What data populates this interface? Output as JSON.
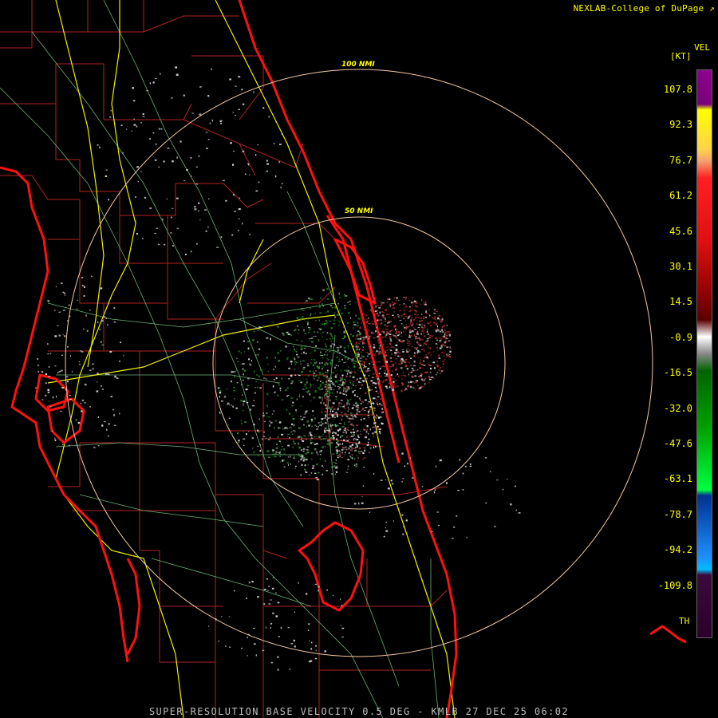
{
  "credit": "NEXLAB-College of DuPage",
  "footer": "SUPER-RESOLUTION BASE VELOCITY 0.5 DEG - KMLB 27 DEC 25 06:02",
  "legend": {
    "title": "VEL",
    "units": "[KT]",
    "ticks": [
      "107.8",
      "92.3",
      "76.7",
      "61.2",
      "45.6",
      "30.1",
      "14.5",
      "-0.9",
      "-16.5",
      "-32.0",
      "-47.6",
      "-63.1",
      "-78.7",
      "-94.2",
      "-109.8"
    ],
    "th_label": "TH"
  },
  "range_rings": {
    "inner": "50 NMI",
    "outer": "100 NMI"
  },
  "colors": {
    "background": "#000000",
    "text": "#ffff00",
    "county_lines": "#b22222",
    "roads": "#f0f000",
    "minor_roads": "#7fd08a",
    "coastline": "#ff1010",
    "rings": "#f5c9a0"
  },
  "icons": [
    "external-link-icon"
  ]
}
